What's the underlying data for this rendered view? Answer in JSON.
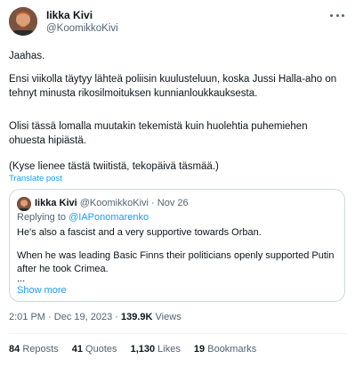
{
  "author": {
    "name": "Iikka Kivi",
    "handle": "@KoomikkoKivi"
  },
  "tweet": {
    "paragraphs": [
      "Jaahas.",
      "Ensi viikolla täytyy lähteä poliisin kuulusteluun, koska Jussi Halla-aho on tehnyt minusta rikosilmoituksen kunnianloukkauksesta.",
      "Olisi tässä lomalla muutakin tekemistä kuin huolehtia puhemiehen ohuesta hipiästä.",
      "(Kyse lienee tästä twiitistä, tekopäivä täsmää.)"
    ],
    "translate_label": "Translate post"
  },
  "quote": {
    "name": "Iikka Kivi",
    "handle": "@KoomikkoKivi",
    "separator": "·",
    "date": "Nov 26",
    "replying_prefix": "Replying to ",
    "replying_to": "@IAPonomarenko",
    "lines": [
      "He's also a fascist and a very supportive towards Orban.",
      "When he was leading Basic Finns their politicians openly supported Putin after he took Crimea.",
      "..."
    ],
    "show_more": "Show more"
  },
  "meta": {
    "time": "2:01 PM",
    "date": "Dec 19, 2023",
    "views_count": "139.9K",
    "views_label": "Views",
    "separator": "·"
  },
  "stats": [
    {
      "count": "84",
      "label": "Reposts"
    },
    {
      "count": "41",
      "label": "Quotes"
    },
    {
      "count": "1,130",
      "label": "Likes"
    },
    {
      "count": "19",
      "label": "Bookmarks"
    }
  ],
  "colors": {
    "link": "#1d9bf0",
    "muted": "#536471",
    "text": "#0f1419",
    "border": "#cfd9de"
  }
}
